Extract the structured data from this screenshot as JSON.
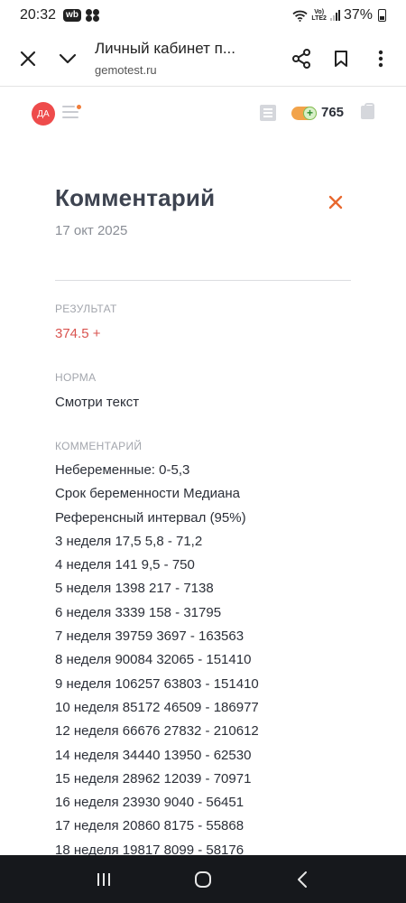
{
  "status_bar": {
    "time": "20:32",
    "app_badge": "wb",
    "network_top": "Vo)",
    "network_bottom": "LTE2",
    "battery": "37%"
  },
  "browser": {
    "page_title": "Личный кабинет п...",
    "url": "gemotest.ru"
  },
  "header": {
    "avatar_initials": "ДА",
    "points": "765",
    "accent_color": "#ee4b4b"
  },
  "detail": {
    "title": "Комментарий",
    "date": "17 окт 2025",
    "result_label": "РЕЗУЛЬТАТ",
    "result_value": "374.5 +",
    "norm_label": "НОРМА",
    "norm_value": "Смотри текст",
    "comment_label": "КОММЕНТАРИЙ",
    "comment_lines": [
      "Небеременные: 0-5,3",
      "Срок беременности Медиана",
      "Референсный интервал (95%)",
      "3 неделя 17,5 5,8 - 71,2",
      "4 неделя 141 9,5 - 750",
      "5 неделя 1398 217 - 7138",
      "6 неделя 3339 158 - 31795",
      "7 неделя 39759 3697 - 163563",
      "8 неделя 90084 32065 - 151410",
      "9 неделя 106257 63803 - 151410",
      "10 неделя 85172 46509 - 186977",
      "12 неделя 66676 27832 - 210612",
      "14 неделя 34440 13950 - 62530",
      "15 неделя 28962 12039 - 70971",
      "16 неделя 23930 9040 - 56451",
      "17 неделя 20860 8175 - 55868",
      "18 неделя 19817 8099 - 58176"
    ]
  },
  "icons": {
    "close": "close-icon",
    "collapse": "chevron-down-icon",
    "share": "share-icon",
    "bookmark": "bookmark-icon",
    "more": "more-vertical-icon"
  }
}
